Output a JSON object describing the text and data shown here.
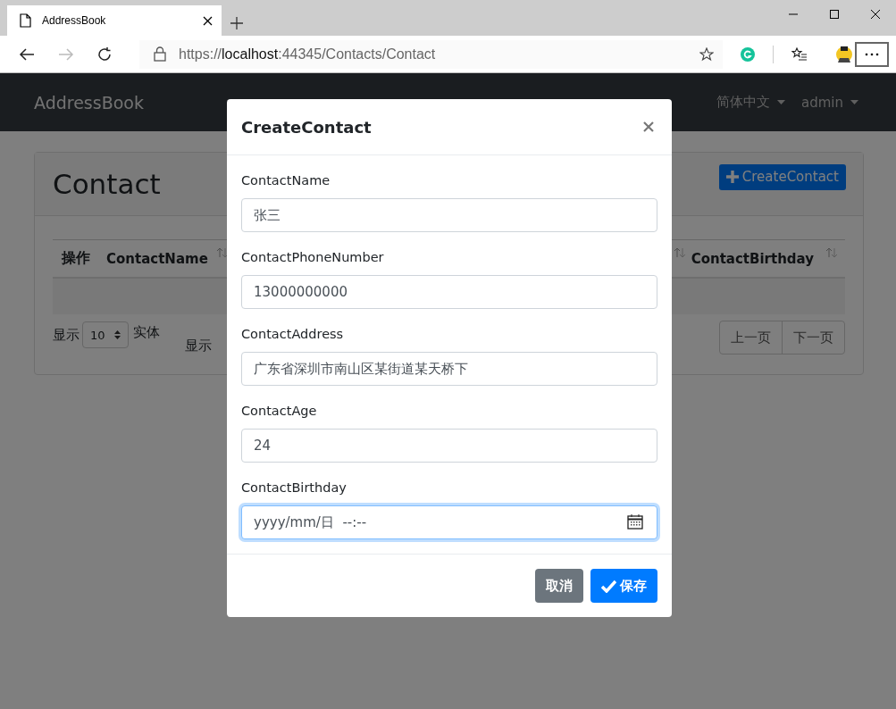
{
  "browser": {
    "tab": {
      "title": "AddressBook"
    },
    "url": {
      "scheme": "https://",
      "host": "localhost",
      "path": ":44345/Contacts/Contact"
    },
    "forward_disabled": true
  },
  "navbar": {
    "brand": "AddressBook",
    "menus": [
      {
        "label": "简体中文"
      },
      {
        "label": "admin"
      }
    ]
  },
  "page": {
    "title": "Contact",
    "create_button": "CreateContact",
    "table": {
      "columns": [
        {
          "label": "操作",
          "sortable": false
        },
        {
          "label": "ContactName",
          "sortable": true
        },
        {
          "label": "ContactBirthday",
          "sortable": true
        }
      ]
    },
    "length_before": "显示",
    "page_length": "10",
    "length_after": "实体",
    "info": "显示",
    "pagination": [
      "上一页",
      "下一页"
    ]
  },
  "modal": {
    "title": "CreateContact",
    "fields": [
      {
        "label": "ContactName",
        "value": "张三",
        "kind": "text",
        "focused": false
      },
      {
        "label": "ContactPhoneNumber",
        "value": "13000000000",
        "kind": "text",
        "focused": false
      },
      {
        "label": "ContactAddress",
        "value": "广东省深圳市南山区某街道某天桥下",
        "kind": "text",
        "focused": false
      },
      {
        "label": "ContactAge",
        "value": "24",
        "kind": "text",
        "focused": false
      },
      {
        "label": "ContactBirthday",
        "placeholder": "yyyy/mm/日  --:--",
        "kind": "datetime",
        "focused": true
      }
    ],
    "buttons": [
      {
        "label": "取消",
        "kind": "secondary"
      },
      {
        "label": "保存",
        "kind": "primary"
      }
    ]
  }
}
